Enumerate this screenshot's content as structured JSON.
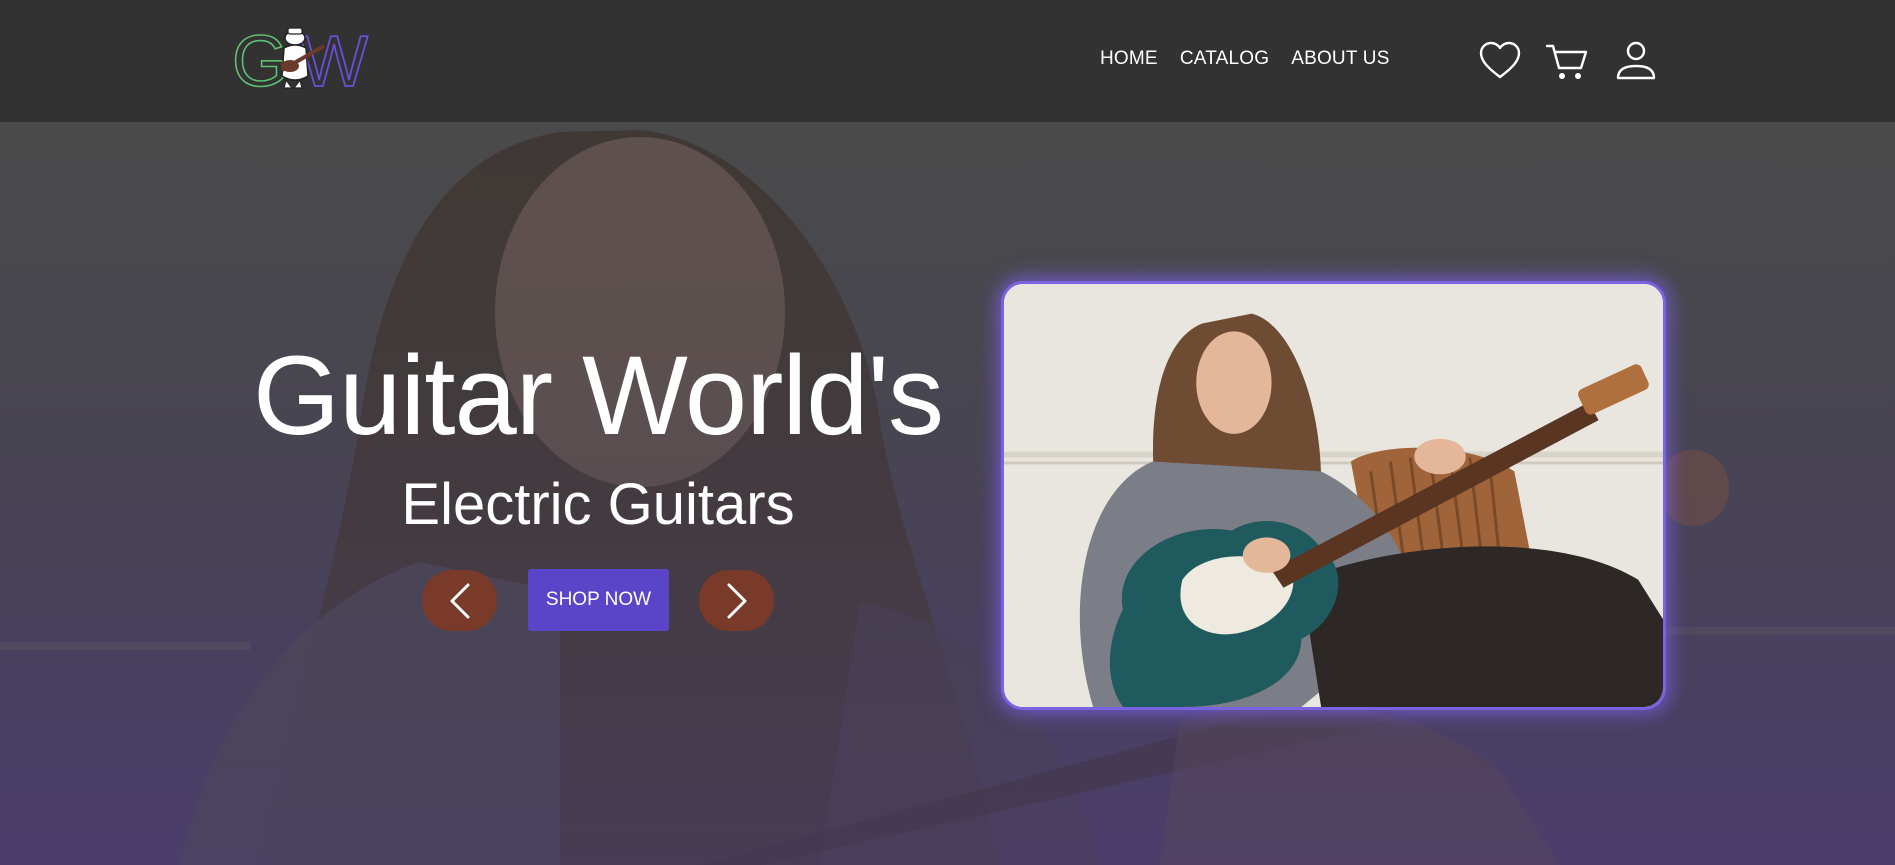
{
  "header": {
    "logo": {
      "text": "GW",
      "icon": "guitar-player-logo-icon"
    },
    "nav": [
      {
        "label": "HOME"
      },
      {
        "label": "CATALOG"
      },
      {
        "label": "ABOUT US"
      }
    ],
    "icons": [
      "heart-icon",
      "cart-icon",
      "user-icon"
    ]
  },
  "hero": {
    "title": "Guitar World's",
    "subtitle": "Electric Guitars",
    "prev_icon": "chevron-left-icon",
    "next_icon": "chevron-right-icon",
    "cta_label": "SHOP NOW"
  },
  "colors": {
    "header_bg": "#323232",
    "accent_purple": "#5a45c8",
    "arrow_brown": "#7a3a2a",
    "card_glow": "#7a63e0"
  }
}
